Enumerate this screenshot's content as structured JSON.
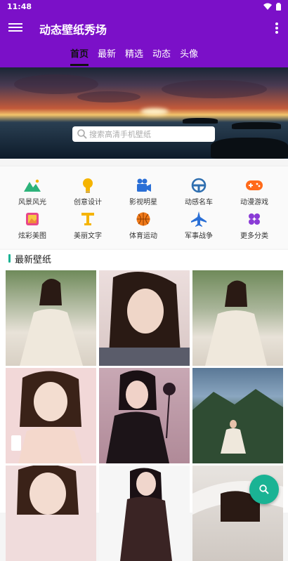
{
  "status_bar": {
    "time": "11:48"
  },
  "app_bar": {
    "title": "动态壁纸秀场"
  },
  "tabs": [
    {
      "label": "首页",
      "active": true
    },
    {
      "label": "最新",
      "active": false
    },
    {
      "label": "精选",
      "active": false
    },
    {
      "label": "动态",
      "active": false
    },
    {
      "label": "头像",
      "active": false
    }
  ],
  "search": {
    "placeholder": "搜索高清手机壁纸"
  },
  "categories": [
    {
      "label": "风景风光",
      "icon": "mountain-icon",
      "color": "#2db37a"
    },
    {
      "label": "创意设计",
      "icon": "lightbulb-icon",
      "color": "#f5b400"
    },
    {
      "label": "影视明星",
      "icon": "video-camera-icon",
      "color": "#2a6fd6"
    },
    {
      "label": "动感名车",
      "icon": "steering-wheel-icon",
      "color": "#2f6fb0"
    },
    {
      "label": "动漫游戏",
      "icon": "gamepad-icon",
      "color": "#ff6a1a"
    },
    {
      "label": "炫彩美图",
      "icon": "photo-icon",
      "color": "#e8478a"
    },
    {
      "label": "美丽文字",
      "icon": "text-t-icon",
      "color": "#f5b400"
    },
    {
      "label": "体育运动",
      "icon": "basketball-icon",
      "color": "#f07a1a"
    },
    {
      "label": "军事战争",
      "icon": "jet-icon",
      "color": "#2a6fd6"
    },
    {
      "label": "更多分类",
      "icon": "more-grid-icon",
      "color": "#8a3bd6"
    }
  ],
  "latest_section": {
    "title": "最新壁纸"
  },
  "colors": {
    "primary": "#7b10c8",
    "accent": "#1ab394"
  }
}
